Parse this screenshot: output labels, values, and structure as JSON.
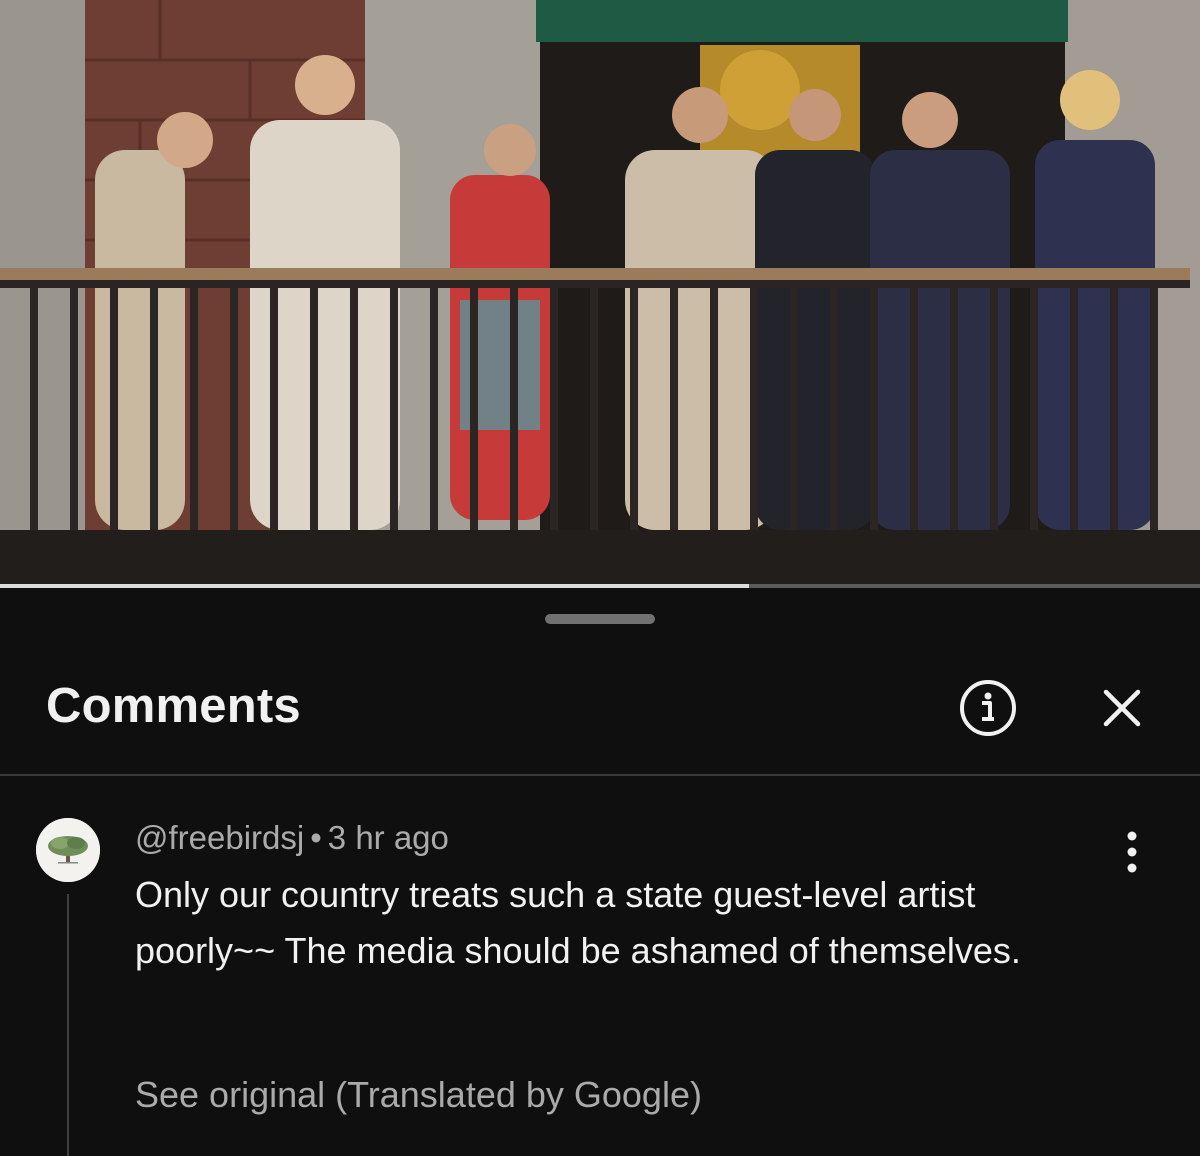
{
  "video": {
    "progress_fraction": 0.624
  },
  "comments_panel": {
    "title": "Comments",
    "info_icon": "info-circle-icon",
    "close_icon": "close-icon"
  },
  "comment": {
    "author": "@freebirdsj",
    "separator": "•",
    "time": "3 hr ago",
    "text": "Only our country treats such a state guest-level artist poorly~~ The media should be ashamed of themselves.",
    "translation_link": "See original (Translated by Google)",
    "more_icon": "more-vertical-icon"
  },
  "colors": {
    "background": "#0f0f0f",
    "primary_text": "#f1f1f1",
    "secondary_text": "#aaaaaa",
    "divider": "#3a3a3a"
  }
}
